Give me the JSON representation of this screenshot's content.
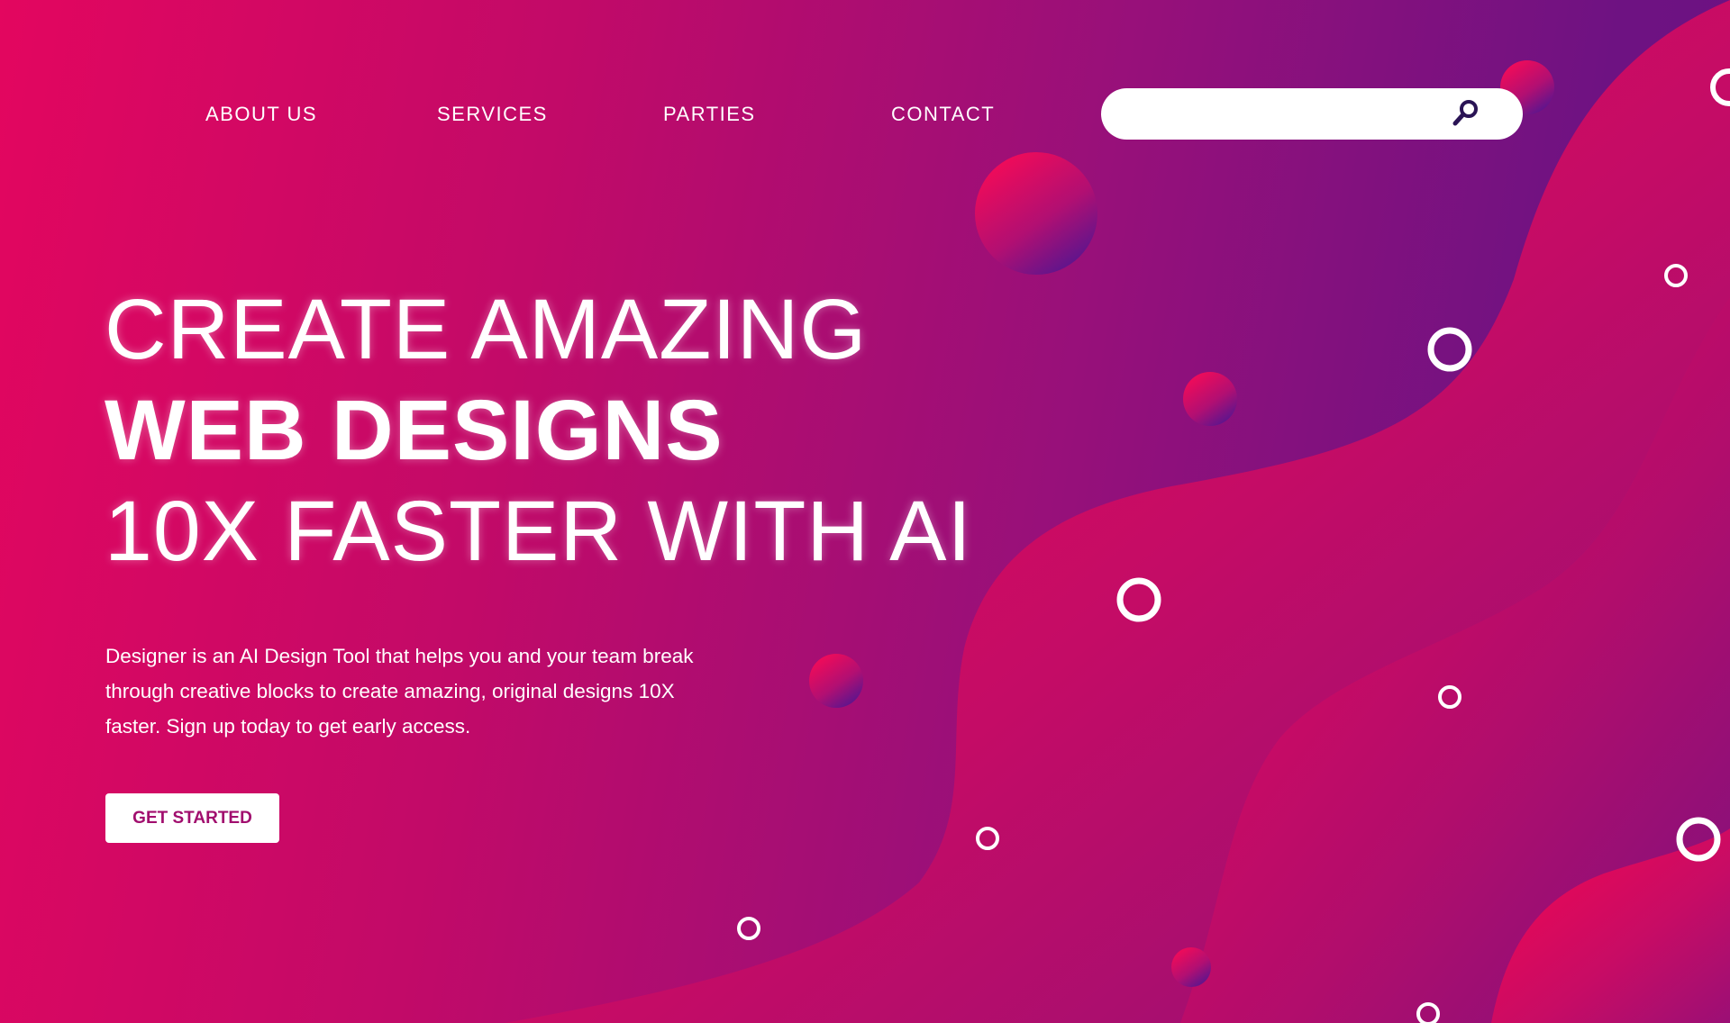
{
  "nav": {
    "items": [
      {
        "label": "ABOUT US"
      },
      {
        "label": "SERVICES"
      },
      {
        "label": "PARTIES"
      },
      {
        "label": "CONTACT"
      }
    ]
  },
  "search": {
    "placeholder": "",
    "value": "",
    "icon": "search-icon"
  },
  "hero": {
    "line1": "CREATE AMAZING",
    "line2": "WEB DESIGNS",
    "line3": "10X FASTER WITH AI",
    "description": "Designer is an AI Design Tool that helps you and your team break through creative blocks to create amazing, original designs 10X faster. Sign up today to get early access.",
    "cta_label": "GET STARTED"
  },
  "colors": {
    "gradient_pink": "#e3065f",
    "gradient_purple": "#6a1083",
    "wave_pink": "#f20555",
    "cta_text": "#a10e6e",
    "search_icon": "#2a1455"
  }
}
